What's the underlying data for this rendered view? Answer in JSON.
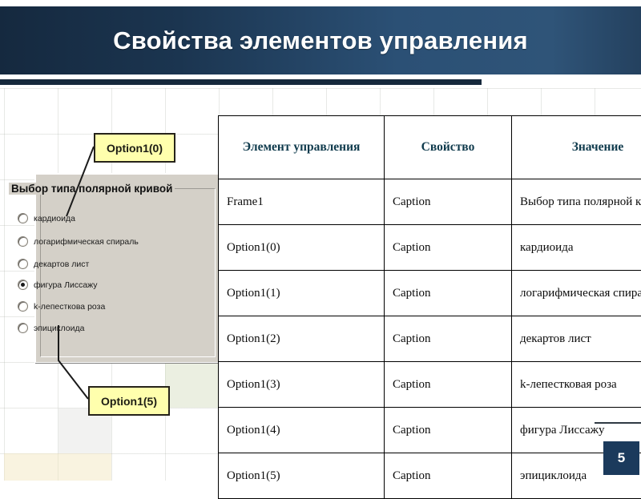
{
  "slide": {
    "title": "Свойства элементов управления",
    "page_number": "5",
    "accent_color": "#1b3a5c",
    "banner_gradient_from": "#15293f",
    "banner_gradient_to": "#2f5478",
    "header_text_color": "#103b4d",
    "callout_fill": "#ffffad"
  },
  "vb_frame": {
    "caption": "Выбор типа полярной кривой",
    "options": [
      {
        "label": "кардиоида",
        "checked": false
      },
      {
        "label": "логарифмическая спираль",
        "checked": false
      },
      {
        "label": "декартов лист",
        "checked": false
      },
      {
        "label": "фигура Лиссажу",
        "checked": true
      },
      {
        "label": "k-лепесткова роза",
        "checked": false
      },
      {
        "label": "эпициклоида",
        "checked": false
      }
    ]
  },
  "callouts": {
    "top": "Option1(0)",
    "bottom": "Option1(5)"
  },
  "table": {
    "headers": {
      "element": "Элемент управления",
      "property": "Свойство",
      "value": "Значение"
    },
    "rows": [
      {
        "element": "Frame1",
        "property": "Caption",
        "value": "Выбор типа полярной кривой"
      },
      {
        "element": "Option1(0)",
        "property": "Caption",
        "value": "кардиоида"
      },
      {
        "element": "Option1(1)",
        "property": "Caption",
        "value": "логарифмическая спираль"
      },
      {
        "element": "Option1(2)",
        "property": "Caption",
        "value": "декартов лист"
      },
      {
        "element": "Option1(3)",
        "property": "Caption",
        "value": "k-лепестковая роза"
      },
      {
        "element": "Option1(4)",
        "property": "Caption",
        "value": "фигура Лиссажу"
      },
      {
        "element": "Option1(5)",
        "property": "Caption",
        "value": "эпициклоида"
      }
    ]
  }
}
